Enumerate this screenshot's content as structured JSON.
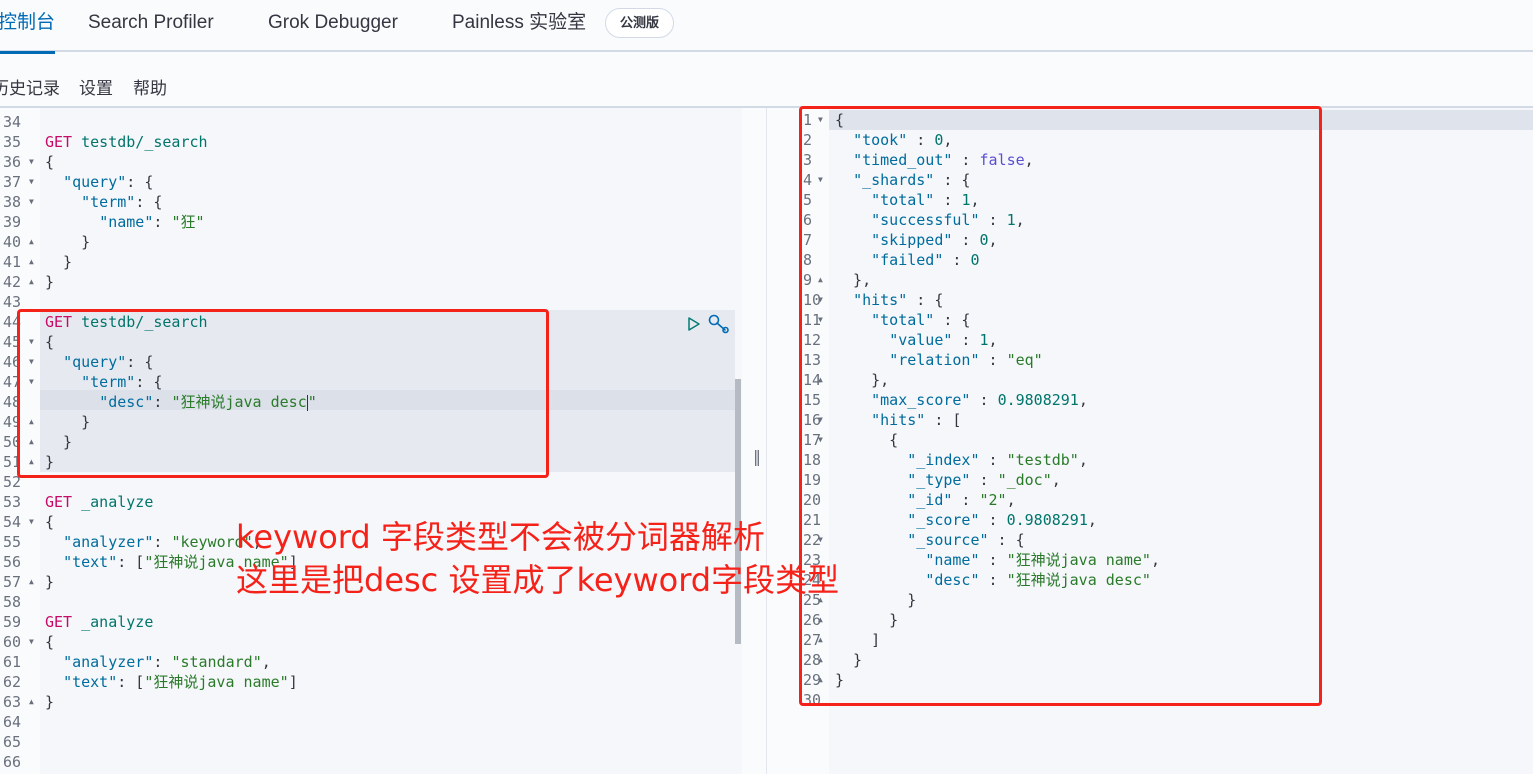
{
  "tabs": [
    {
      "label": "控制台",
      "active": true
    },
    {
      "label": "Search Profiler",
      "active": false
    },
    {
      "label": "Grok Debugger",
      "active": false
    },
    {
      "label": "Painless 实验室",
      "active": false
    }
  ],
  "beta_badge": "公测版",
  "subnav": [
    "历史记录",
    "设置",
    "帮助"
  ],
  "request_editor": {
    "lines": [
      {
        "n": "34",
        "fold": "",
        "tokens": []
      },
      {
        "n": "35",
        "fold": "",
        "tokens": [
          [
            "m",
            "GET"
          ],
          [
            "p",
            " "
          ],
          [
            "u",
            "testdb/_search"
          ]
        ]
      },
      {
        "n": "36",
        "fold": "▼",
        "tokens": [
          [
            "p",
            "{"
          ]
        ]
      },
      {
        "n": "37",
        "fold": "▼",
        "tokens": [
          [
            "p",
            "  "
          ],
          [
            "k",
            "\"query\""
          ],
          [
            "p",
            ": {"
          ]
        ]
      },
      {
        "n": "38",
        "fold": "▼",
        "tokens": [
          [
            "p",
            "    "
          ],
          [
            "k",
            "\"term\""
          ],
          [
            "p",
            ": {"
          ]
        ]
      },
      {
        "n": "39",
        "fold": "",
        "tokens": [
          [
            "p",
            "      "
          ],
          [
            "k",
            "\"name\""
          ],
          [
            "p",
            ": "
          ],
          [
            "s",
            "\"狂\""
          ]
        ]
      },
      {
        "n": "40",
        "fold": "▲",
        "tokens": [
          [
            "p",
            "    }"
          ]
        ]
      },
      {
        "n": "41",
        "fold": "▲",
        "tokens": [
          [
            "p",
            "  }"
          ]
        ]
      },
      {
        "n": "42",
        "fold": "▲",
        "tokens": [
          [
            "p",
            "}"
          ]
        ]
      },
      {
        "n": "43",
        "fold": "",
        "tokens": []
      },
      {
        "n": "44",
        "fold": "",
        "tokens": [
          [
            "m",
            "GET"
          ],
          [
            "p",
            " "
          ],
          [
            "u",
            "testdb/_search"
          ]
        ]
      },
      {
        "n": "45",
        "fold": "▼",
        "tokens": [
          [
            "p",
            "{"
          ]
        ]
      },
      {
        "n": "46",
        "fold": "▼",
        "tokens": [
          [
            "p",
            "  "
          ],
          [
            "k",
            "\"query\""
          ],
          [
            "p",
            ": {"
          ]
        ]
      },
      {
        "n": "47",
        "fold": "▼",
        "tokens": [
          [
            "p",
            "    "
          ],
          [
            "k",
            "\"term\""
          ],
          [
            "p",
            ": {"
          ]
        ]
      },
      {
        "n": "48",
        "fold": "",
        "tokens": [
          [
            "p",
            "      "
          ],
          [
            "k",
            "\"desc\""
          ],
          [
            "p",
            ": "
          ],
          [
            "s",
            "\"狂神说java desc"
          ],
          [
            "c",
            ""
          ],
          [
            "s",
            "\""
          ]
        ]
      },
      {
        "n": "49",
        "fold": "▲",
        "tokens": [
          [
            "p",
            "    }"
          ]
        ]
      },
      {
        "n": "50",
        "fold": "▲",
        "tokens": [
          [
            "p",
            "  }"
          ]
        ]
      },
      {
        "n": "51",
        "fold": "▲",
        "tokens": [
          [
            "p",
            "}"
          ]
        ]
      },
      {
        "n": "52",
        "fold": "",
        "tokens": []
      },
      {
        "n": "53",
        "fold": "",
        "tokens": [
          [
            "m",
            "GET"
          ],
          [
            "p",
            " "
          ],
          [
            "u",
            "_analyze"
          ]
        ]
      },
      {
        "n": "54",
        "fold": "▼",
        "tokens": [
          [
            "p",
            "{"
          ]
        ]
      },
      {
        "n": "55",
        "fold": "",
        "tokens": [
          [
            "p",
            "  "
          ],
          [
            "k",
            "\"analyzer\""
          ],
          [
            "p",
            ": "
          ],
          [
            "s",
            "\"keyword\""
          ],
          [
            "p",
            ","
          ]
        ]
      },
      {
        "n": "56",
        "fold": "",
        "tokens": [
          [
            "p",
            "  "
          ],
          [
            "k",
            "\"text\""
          ],
          [
            "p",
            ": ["
          ],
          [
            "s",
            "\"狂神说java name\""
          ],
          [
            "p",
            "]"
          ]
        ]
      },
      {
        "n": "57",
        "fold": "▲",
        "tokens": [
          [
            "p",
            "}"
          ]
        ]
      },
      {
        "n": "58",
        "fold": "",
        "tokens": []
      },
      {
        "n": "59",
        "fold": "",
        "tokens": [
          [
            "m",
            "GET"
          ],
          [
            "p",
            " "
          ],
          [
            "u",
            "_analyze"
          ]
        ]
      },
      {
        "n": "60",
        "fold": "▼",
        "tokens": [
          [
            "p",
            "{"
          ]
        ]
      },
      {
        "n": "61",
        "fold": "",
        "tokens": [
          [
            "p",
            "  "
          ],
          [
            "k",
            "\"analyzer\""
          ],
          [
            "p",
            ": "
          ],
          [
            "s",
            "\"standard\""
          ],
          [
            "p",
            ","
          ]
        ]
      },
      {
        "n": "62",
        "fold": "",
        "tokens": [
          [
            "p",
            "  "
          ],
          [
            "k",
            "\"text\""
          ],
          [
            "p",
            ": ["
          ],
          [
            "s",
            "\"狂神说java name\""
          ],
          [
            "p",
            "]"
          ]
        ]
      },
      {
        "n": "63",
        "fold": "▲",
        "tokens": [
          [
            "p",
            "}"
          ]
        ]
      },
      {
        "n": "64",
        "fold": "",
        "tokens": []
      },
      {
        "n": "65",
        "fold": "",
        "tokens": []
      },
      {
        "n": "66",
        "fold": "",
        "tokens": []
      }
    ]
  },
  "response_editor": {
    "lines": [
      {
        "n": "1",
        "fold": "▼",
        "tokens": [
          [
            "p",
            "{"
          ]
        ]
      },
      {
        "n": "2",
        "fold": "",
        "tokens": [
          [
            "p",
            "  "
          ],
          [
            "k",
            "\"took\""
          ],
          [
            "p",
            " : "
          ],
          [
            "d",
            "0"
          ],
          [
            "p",
            ","
          ]
        ]
      },
      {
        "n": "3",
        "fold": "",
        "tokens": [
          [
            "p",
            "  "
          ],
          [
            "k",
            "\"timed_out\""
          ],
          [
            "p",
            " : "
          ],
          [
            "b",
            "false"
          ],
          [
            "p",
            ","
          ]
        ]
      },
      {
        "n": "4",
        "fold": "▼",
        "tokens": [
          [
            "p",
            "  "
          ],
          [
            "k",
            "\"_shards\""
          ],
          [
            "p",
            " : {"
          ]
        ]
      },
      {
        "n": "5",
        "fold": "",
        "tokens": [
          [
            "p",
            "    "
          ],
          [
            "k",
            "\"total\""
          ],
          [
            "p",
            " : "
          ],
          [
            "d",
            "1"
          ],
          [
            "p",
            ","
          ]
        ]
      },
      {
        "n": "6",
        "fold": "",
        "tokens": [
          [
            "p",
            "    "
          ],
          [
            "k",
            "\"successful\""
          ],
          [
            "p",
            " : "
          ],
          [
            "d",
            "1"
          ],
          [
            "p",
            ","
          ]
        ]
      },
      {
        "n": "7",
        "fold": "",
        "tokens": [
          [
            "p",
            "    "
          ],
          [
            "k",
            "\"skipped\""
          ],
          [
            "p",
            " : "
          ],
          [
            "d",
            "0"
          ],
          [
            "p",
            ","
          ]
        ]
      },
      {
        "n": "8",
        "fold": "",
        "tokens": [
          [
            "p",
            "    "
          ],
          [
            "k",
            "\"failed\""
          ],
          [
            "p",
            " : "
          ],
          [
            "d",
            "0"
          ]
        ]
      },
      {
        "n": "9",
        "fold": "▲",
        "tokens": [
          [
            "p",
            "  },"
          ]
        ]
      },
      {
        "n": "10",
        "fold": "▼",
        "tokens": [
          [
            "p",
            "  "
          ],
          [
            "k",
            "\"hits\""
          ],
          [
            "p",
            " : {"
          ]
        ]
      },
      {
        "n": "11",
        "fold": "▼",
        "tokens": [
          [
            "p",
            "    "
          ],
          [
            "k",
            "\"total\""
          ],
          [
            "p",
            " : {"
          ]
        ]
      },
      {
        "n": "12",
        "fold": "",
        "tokens": [
          [
            "p",
            "      "
          ],
          [
            "k",
            "\"value\""
          ],
          [
            "p",
            " : "
          ],
          [
            "d",
            "1"
          ],
          [
            "p",
            ","
          ]
        ]
      },
      {
        "n": "13",
        "fold": "",
        "tokens": [
          [
            "p",
            "      "
          ],
          [
            "k",
            "\"relation\""
          ],
          [
            "p",
            " : "
          ],
          [
            "s",
            "\"eq\""
          ]
        ]
      },
      {
        "n": "14",
        "fold": "▲",
        "tokens": [
          [
            "p",
            "    },"
          ]
        ]
      },
      {
        "n": "15",
        "fold": "",
        "tokens": [
          [
            "p",
            "    "
          ],
          [
            "k",
            "\"max_score\""
          ],
          [
            "p",
            " : "
          ],
          [
            "d",
            "0.9808291"
          ],
          [
            "p",
            ","
          ]
        ]
      },
      {
        "n": "16",
        "fold": "▼",
        "tokens": [
          [
            "p",
            "    "
          ],
          [
            "k",
            "\"hits\""
          ],
          [
            "p",
            " : ["
          ]
        ]
      },
      {
        "n": "17",
        "fold": "▼",
        "tokens": [
          [
            "p",
            "      {"
          ]
        ]
      },
      {
        "n": "18",
        "fold": "",
        "tokens": [
          [
            "p",
            "        "
          ],
          [
            "k",
            "\"_index\""
          ],
          [
            "p",
            " : "
          ],
          [
            "s",
            "\"testdb\""
          ],
          [
            "p",
            ","
          ]
        ]
      },
      {
        "n": "19",
        "fold": "",
        "tokens": [
          [
            "p",
            "        "
          ],
          [
            "k",
            "\"_type\""
          ],
          [
            "p",
            " : "
          ],
          [
            "s",
            "\"_doc\""
          ],
          [
            "p",
            ","
          ]
        ]
      },
      {
        "n": "20",
        "fold": "",
        "tokens": [
          [
            "p",
            "        "
          ],
          [
            "k",
            "\"_id\""
          ],
          [
            "p",
            " : "
          ],
          [
            "s",
            "\"2\""
          ],
          [
            "p",
            ","
          ]
        ]
      },
      {
        "n": "21",
        "fold": "",
        "tokens": [
          [
            "p",
            "        "
          ],
          [
            "k",
            "\"_score\""
          ],
          [
            "p",
            " : "
          ],
          [
            "d",
            "0.9808291"
          ],
          [
            "p",
            ","
          ]
        ]
      },
      {
        "n": "22",
        "fold": "▼",
        "tokens": [
          [
            "p",
            "        "
          ],
          [
            "k",
            "\"_source\""
          ],
          [
            "p",
            " : {"
          ]
        ]
      },
      {
        "n": "23",
        "fold": "",
        "tokens": [
          [
            "p",
            "          "
          ],
          [
            "k",
            "\"name\""
          ],
          [
            "p",
            " : "
          ],
          [
            "s",
            "\"狂神说java name\""
          ],
          [
            "p",
            ","
          ]
        ]
      },
      {
        "n": "24",
        "fold": "",
        "tokens": [
          [
            "p",
            "          "
          ],
          [
            "k",
            "\"desc\""
          ],
          [
            "p",
            " : "
          ],
          [
            "s",
            "\"狂神说java desc\""
          ]
        ]
      },
      {
        "n": "25",
        "fold": "▲",
        "tokens": [
          [
            "p",
            "        }"
          ]
        ]
      },
      {
        "n": "26",
        "fold": "▲",
        "tokens": [
          [
            "p",
            "      }"
          ]
        ]
      },
      {
        "n": "27",
        "fold": "▲",
        "tokens": [
          [
            "p",
            "    ]"
          ]
        ]
      },
      {
        "n": "28",
        "fold": "▲",
        "tokens": [
          [
            "p",
            "  }"
          ]
        ]
      },
      {
        "n": "29",
        "fold": "▲",
        "tokens": [
          [
            "p",
            "}"
          ]
        ]
      },
      {
        "n": "30",
        "fold": "",
        "tokens": []
      }
    ]
  },
  "annotation": {
    "line1": "keyword 字段类型不会被分词器解析",
    "line2": "这里是把desc 设置成了keyword字段类型",
    "color": "#f5221a"
  },
  "colors": {
    "accent": "#006bb4",
    "method": "#c80a68",
    "key": "#006c9e",
    "string": "#2a7a2a",
    "number": "#00756c",
    "boolean": "#5a4ed1"
  },
  "icons": {
    "run": "play-triangle",
    "settings": "wrench"
  }
}
